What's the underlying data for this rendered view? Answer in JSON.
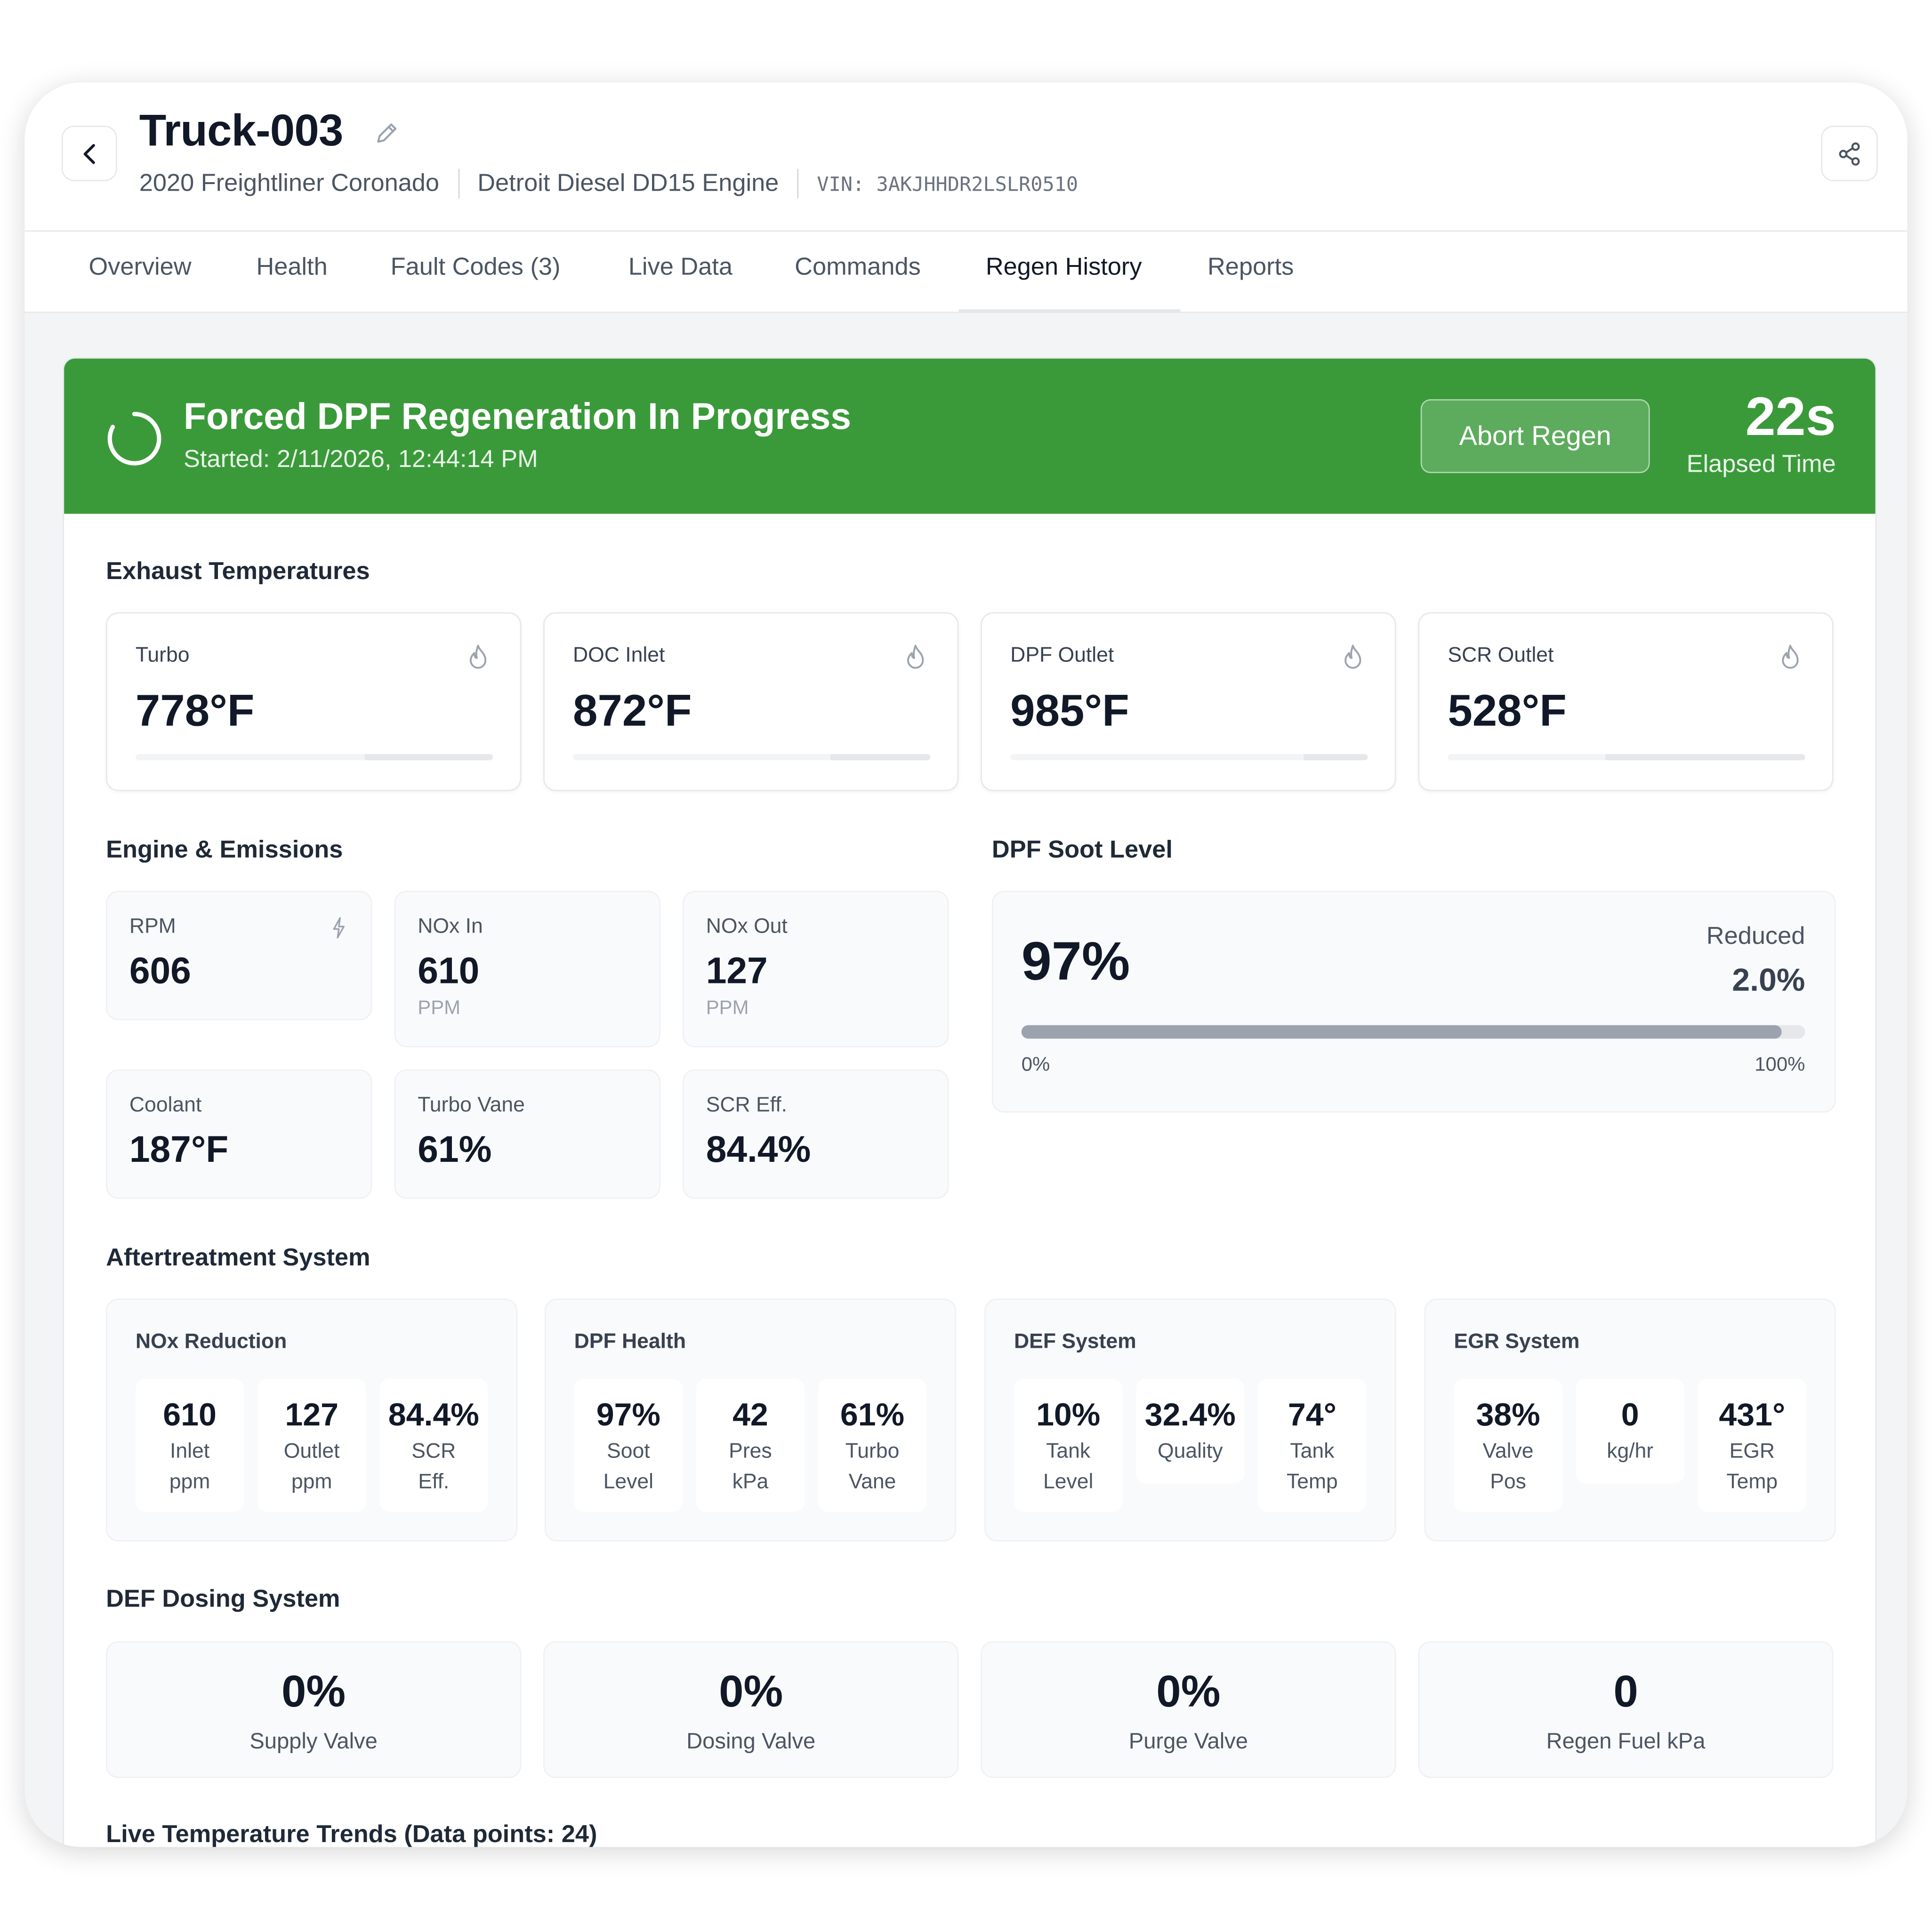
{
  "header": {
    "title": "Truck-003",
    "vehicle": "2020 Freightliner Coronado",
    "engine": "Detroit Diesel DD15 Engine",
    "vin": "VIN: 3AKJHHDR2LSLR0510"
  },
  "tabs": [
    {
      "label": "Overview"
    },
    {
      "label": "Health"
    },
    {
      "label": "Fault Codes (3)"
    },
    {
      "label": "Live Data"
    },
    {
      "label": "Commands"
    },
    {
      "label": "Regen History",
      "active": true
    },
    {
      "label": "Reports"
    }
  ],
  "banner": {
    "title": "Forced DPF Regeneration In Progress",
    "started": "Started: 2/11/2026, 12:44:14 PM",
    "abort_label": "Abort Regen",
    "elapsed_value": "22s",
    "elapsed_label": "Elapsed Time",
    "color": "#3a9a3a"
  },
  "exhaust": {
    "title": "Exhaust Temperatures",
    "cards": [
      {
        "label": "Turbo",
        "value": "778°F",
        "level": 0.36
      },
      {
        "label": "DOC Inlet",
        "value": "872°F",
        "level": 0.28
      },
      {
        "label": "DPF Outlet",
        "value": "985°F",
        "level": 0.18
      },
      {
        "label": "SCR Outlet",
        "value": "528°F",
        "level": 0.56
      }
    ]
  },
  "engine": {
    "title": "Engine & Emissions",
    "cards": [
      {
        "label": "RPM",
        "value": "606",
        "unit": ""
      },
      {
        "label": "NOx In",
        "value": "610",
        "unit": "PPM"
      },
      {
        "label": "NOx Out",
        "value": "127",
        "unit": "PPM"
      },
      {
        "label": "Coolant",
        "value": "187°F",
        "unit": ""
      },
      {
        "label": "Turbo Vane",
        "value": "61%",
        "unit": ""
      },
      {
        "label": "SCR Eff.",
        "value": "84.4%",
        "unit": ""
      }
    ]
  },
  "soot": {
    "title": "DPF Soot Level",
    "value": "97%",
    "level": 0.97,
    "reduced_label": "Reduced",
    "reduced_value": "2.0%",
    "min_label": "0%",
    "max_label": "100%"
  },
  "aftertreatment": {
    "title": "Aftertreatment System",
    "cards": [
      {
        "title": "NOx Reduction",
        "items": [
          {
            "value": "610",
            "l1": "Inlet",
            "l2": "ppm"
          },
          {
            "value": "127",
            "l1": "Outlet",
            "l2": "ppm"
          },
          {
            "value": "84.4%",
            "l1": "SCR",
            "l2": "Eff."
          }
        ]
      },
      {
        "title": "DPF Health",
        "items": [
          {
            "value": "97%",
            "l1": "Soot",
            "l2": "Level"
          },
          {
            "value": "42",
            "l1": "Pres",
            "l2": "kPa"
          },
          {
            "value": "61%",
            "l1": "Turbo",
            "l2": "Vane"
          }
        ]
      },
      {
        "title": "DEF System",
        "items": [
          {
            "value": "10%",
            "l1": "Tank",
            "l2": "Level"
          },
          {
            "value": "32.4%",
            "l1": "Quality",
            "l2": ""
          },
          {
            "value": "74°",
            "l1": "Tank",
            "l2": "Temp"
          }
        ]
      },
      {
        "title": "EGR System",
        "items": [
          {
            "value": "38%",
            "l1": "Valve",
            "l2": "Pos"
          },
          {
            "value": "0",
            "l1": "kg/hr",
            "l2": ""
          },
          {
            "value": "431°",
            "l1": "EGR",
            "l2": "Temp"
          }
        ]
      }
    ]
  },
  "dosing": {
    "title": "DEF Dosing System",
    "cards": [
      {
        "value": "0%",
        "label": "Supply Valve"
      },
      {
        "value": "0%",
        "label": "Dosing Valve"
      },
      {
        "value": "0%",
        "label": "Purge Valve"
      },
      {
        "value": "0",
        "label": "Regen Fuel kPa"
      }
    ]
  },
  "trends": {
    "title": "Live Temperature Trends (Data points: 24)"
  }
}
